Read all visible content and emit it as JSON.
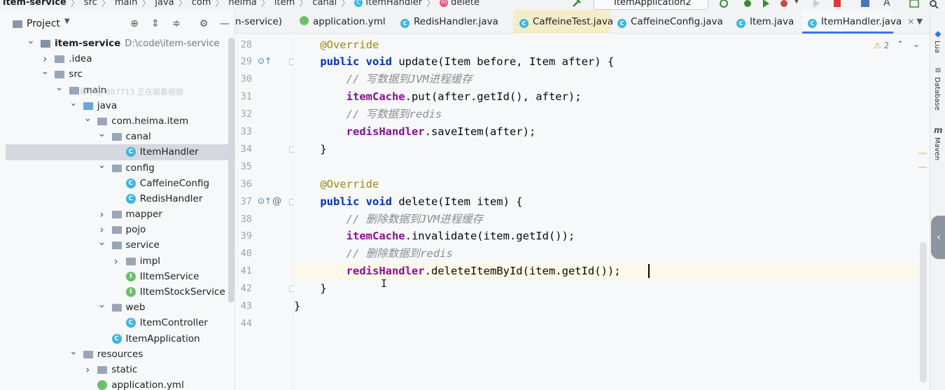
{
  "breadcrumbs": [
    "item-service",
    "src",
    "main",
    "java",
    "com",
    "heima",
    "item",
    "canal",
    "ItemHandler",
    "delete"
  ],
  "run_config": "ItemApplication2",
  "project": {
    "title": "Project",
    "tree": [
      {
        "label": "item-service",
        "path": "D:\\code\\item-service",
        "indent": 0,
        "arrow": "down",
        "icon": "module",
        "bold": true
      },
      {
        "label": ".idea",
        "indent": 1,
        "arrow": "right",
        "icon": "folder"
      },
      {
        "label": "src",
        "indent": 1,
        "arrow": "down",
        "icon": "folder"
      },
      {
        "label": "main",
        "indent": 2,
        "arrow": "down",
        "icon": "folder"
      },
      {
        "label": "java",
        "indent": 3,
        "arrow": "down",
        "icon": "folder-blue"
      },
      {
        "label": "com.heima.item",
        "indent": 4,
        "arrow": "down",
        "icon": "folder"
      },
      {
        "label": "canal",
        "indent": 5,
        "arrow": "down",
        "icon": "folder"
      },
      {
        "label": "ItemHandler",
        "indent": 6,
        "arrow": "",
        "icon": "class",
        "selected": true
      },
      {
        "label": "config",
        "indent": 5,
        "arrow": "down",
        "icon": "folder"
      },
      {
        "label": "CaffeineConfig",
        "indent": 6,
        "arrow": "",
        "icon": "class"
      },
      {
        "label": "RedisHandler",
        "indent": 6,
        "arrow": "",
        "icon": "class"
      },
      {
        "label": "mapper",
        "indent": 5,
        "arrow": "right",
        "icon": "folder"
      },
      {
        "label": "pojo",
        "indent": 5,
        "arrow": "right",
        "icon": "folder"
      },
      {
        "label": "service",
        "indent": 5,
        "arrow": "down",
        "icon": "folder"
      },
      {
        "label": "impl",
        "indent": 6,
        "arrow": "right",
        "icon": "folder"
      },
      {
        "label": "IItemService",
        "indent": 6,
        "arrow": "",
        "icon": "iface"
      },
      {
        "label": "IItemStockService",
        "indent": 6,
        "arrow": "",
        "icon": "iface"
      },
      {
        "label": "web",
        "indent": 5,
        "arrow": "down",
        "icon": "folder"
      },
      {
        "label": "ItemController",
        "indent": 6,
        "arrow": "",
        "icon": "class"
      },
      {
        "label": "ItemApplication",
        "indent": 5,
        "arrow": "",
        "icon": "class"
      },
      {
        "label": "resources",
        "indent": 3,
        "arrow": "down",
        "icon": "folder"
      },
      {
        "label": "static",
        "indent": 4,
        "arrow": "right",
        "icon": "folder"
      },
      {
        "label": "application.yml",
        "indent": 4,
        "arrow": "",
        "icon": "yml"
      }
    ]
  },
  "watermark": "樟学谷 887713 正在观看视频",
  "tabs": [
    {
      "label": "n-service)",
      "icon": "",
      "active": false
    },
    {
      "label": "application.yml",
      "icon": "yml",
      "active": false
    },
    {
      "label": "RedisHandler.java",
      "icon": "class",
      "active": false
    },
    {
      "label": "CaffeineTest.java",
      "icon": "class",
      "active": false,
      "highlight": true
    },
    {
      "label": "CaffeineConfig.java",
      "icon": "class",
      "active": false
    },
    {
      "label": "Item.java",
      "icon": "class",
      "active": false
    },
    {
      "label": "ItemHandler.java",
      "icon": "class",
      "active": true
    }
  ],
  "editor": {
    "warnings": "2",
    "lines": [
      {
        "n": "28",
        "tokens": [
          [
            "anno",
            "    @Override"
          ]
        ]
      },
      {
        "n": "29",
        "tokens": [
          [
            "kw",
            "    public void "
          ],
          [
            "txt",
            "update(Item before, Item after) {"
          ]
        ]
      },
      {
        "n": "30",
        "tokens": [
          [
            "cm",
            "        // 写数据到JVM进程缓存"
          ]
        ]
      },
      {
        "n": "31",
        "tokens": [
          [
            "field",
            "        itemCache"
          ],
          [
            "txt",
            ".put(after.getId(), after);"
          ]
        ]
      },
      {
        "n": "32",
        "tokens": [
          [
            "cm",
            "        // 写数据到redis"
          ]
        ]
      },
      {
        "n": "33",
        "tokens": [
          [
            "field",
            "        redisHandler"
          ],
          [
            "txt",
            ".saveItem(after);"
          ]
        ]
      },
      {
        "n": "34",
        "tokens": [
          [
            "txt",
            "    }"
          ]
        ]
      },
      {
        "n": "35",
        "tokens": []
      },
      {
        "n": "36",
        "tokens": [
          [
            "anno",
            "    @Override"
          ]
        ]
      },
      {
        "n": "37",
        "tokens": [
          [
            "kw",
            "    public void "
          ],
          [
            "txt",
            "delete(Item item) {"
          ]
        ]
      },
      {
        "n": "38",
        "tokens": [
          [
            "cm",
            "        // 删除数据到JVM进程缓存"
          ]
        ]
      },
      {
        "n": "39",
        "tokens": [
          [
            "field",
            "        itemCache"
          ],
          [
            "txt",
            ".invalidate(item.getId());"
          ]
        ]
      },
      {
        "n": "40",
        "tokens": [
          [
            "cm",
            "        // 删除数据到redis"
          ]
        ]
      },
      {
        "n": "41",
        "tokens": [
          [
            "field",
            "        redisHandler"
          ],
          [
            "txt",
            ".deleteItemById(item.getId());"
          ]
        ]
      },
      {
        "n": "42",
        "tokens": [
          [
            "txt",
            "    }"
          ]
        ]
      },
      {
        "n": "43",
        "tokens": [
          [
            "txt",
            "}"
          ]
        ]
      },
      {
        "n": "44",
        "tokens": []
      }
    ]
  },
  "right_tools": [
    "Lua",
    "Database",
    "Maven"
  ],
  "icons": {
    "header": [
      "crosshair-icon",
      "expand-all-icon",
      "collapse-all-icon",
      "gear-icon",
      "minimize-icon"
    ],
    "gutter_override": "override-up-arrow-icon",
    "gutter_at": "annotation-at-icon"
  }
}
